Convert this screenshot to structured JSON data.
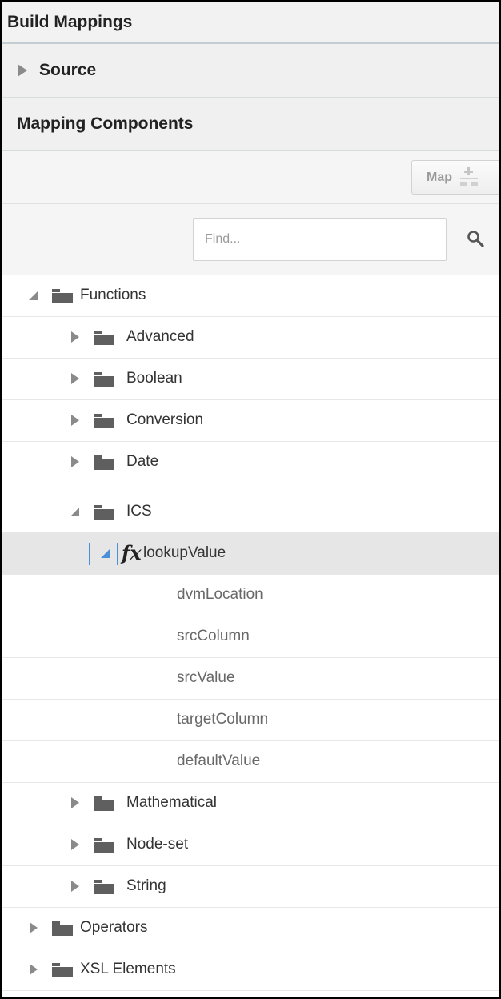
{
  "header": {
    "title": "Build Mappings",
    "source_label": "Source",
    "mapping_components_label": "Mapping Components"
  },
  "toolbar": {
    "map_label": "Map"
  },
  "search": {
    "placeholder": "Find..."
  },
  "tree": {
    "functions": "Functions",
    "advanced": "Advanced",
    "boolean": "Boolean",
    "conversion": "Conversion",
    "date": "Date",
    "ics": "ICS",
    "lookup_value": "lookupValue",
    "fx_symbol": "fx",
    "params": [
      "dvmLocation",
      "srcColumn",
      "srcValue",
      "targetColumn",
      "defaultValue"
    ],
    "mathematical": "Mathematical",
    "node_set": "Node-set",
    "string": "String",
    "operators": "Operators",
    "xsl_elements": "XSL Elements"
  },
  "colors": {
    "accent": "#4a90d9",
    "folder": "#5f5f5f",
    "caret": "#8a8a8a",
    "selected_row": "#e6e6e6"
  },
  "icons": {
    "collapsed": "caret-right-icon",
    "expanded": "caret-down-icon",
    "folder": "folder-icon",
    "function": "function-icon",
    "search": "search-icon",
    "map": "map-add-icon"
  }
}
